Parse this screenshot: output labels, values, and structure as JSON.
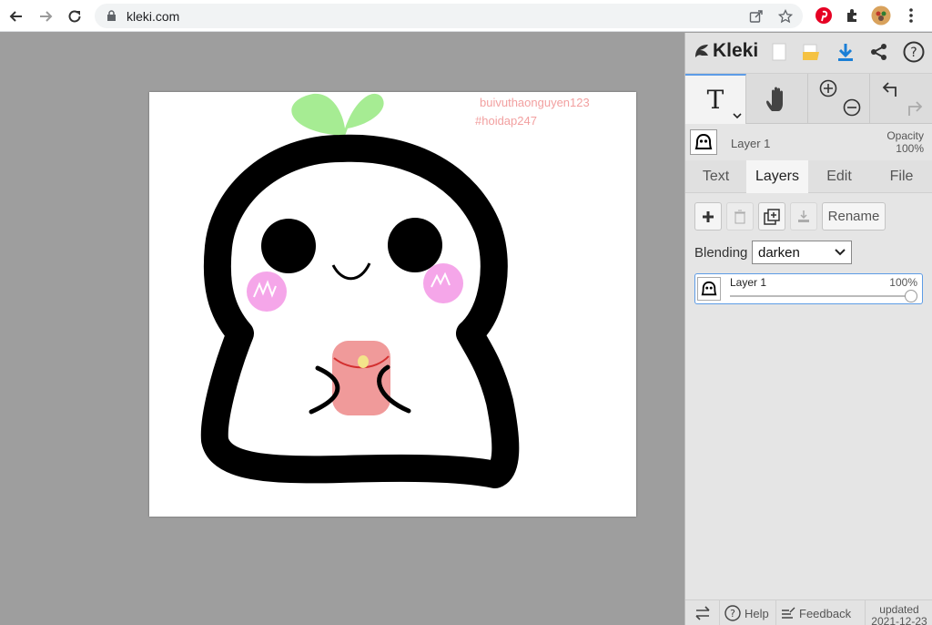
{
  "browser": {
    "url": "kleki.com",
    "icons": [
      "back-arrow-icon",
      "forward-arrow-icon",
      "reload-icon",
      "lock-icon",
      "share-icon",
      "star-icon",
      "pinterest-icon",
      "extensions-icon",
      "profile-avatar",
      "more-icon"
    ]
  },
  "canvas": {
    "watermark_user": "buivuthaonguyen123",
    "watermark_tag": "#hoidap247"
  },
  "panel": {
    "brand": "Kleki",
    "top_buttons": [
      "new-image-icon",
      "open-folder-icon",
      "download-icon",
      "share-icon",
      "help-icon"
    ],
    "tools": {
      "text_tool": "T",
      "icons": [
        "text-tool-icon",
        "hand-tool-icon",
        "zoom-in-icon",
        "zoom-out-icon",
        "undo-icon",
        "redo-icon"
      ]
    },
    "current_layer": {
      "name": "Layer 1",
      "opacity_label": "Opacity",
      "opacity_value": "100%"
    },
    "tabs": [
      "Text",
      "Layers",
      "Edit",
      "File"
    ],
    "active_tab": "Layers",
    "layer_buttons": {
      "rename": "Rename"
    },
    "blending": {
      "label": "Blending",
      "value": "darken"
    },
    "layers": [
      {
        "name": "Layer 1",
        "opacity": "100%",
        "opacity_fraction": 1.0
      }
    ],
    "footer": {
      "help": "Help",
      "feedback": "Feedback",
      "updated_label": "updated",
      "updated_date": "2021-12-23"
    },
    "accent_color": "#5d9ce6"
  }
}
